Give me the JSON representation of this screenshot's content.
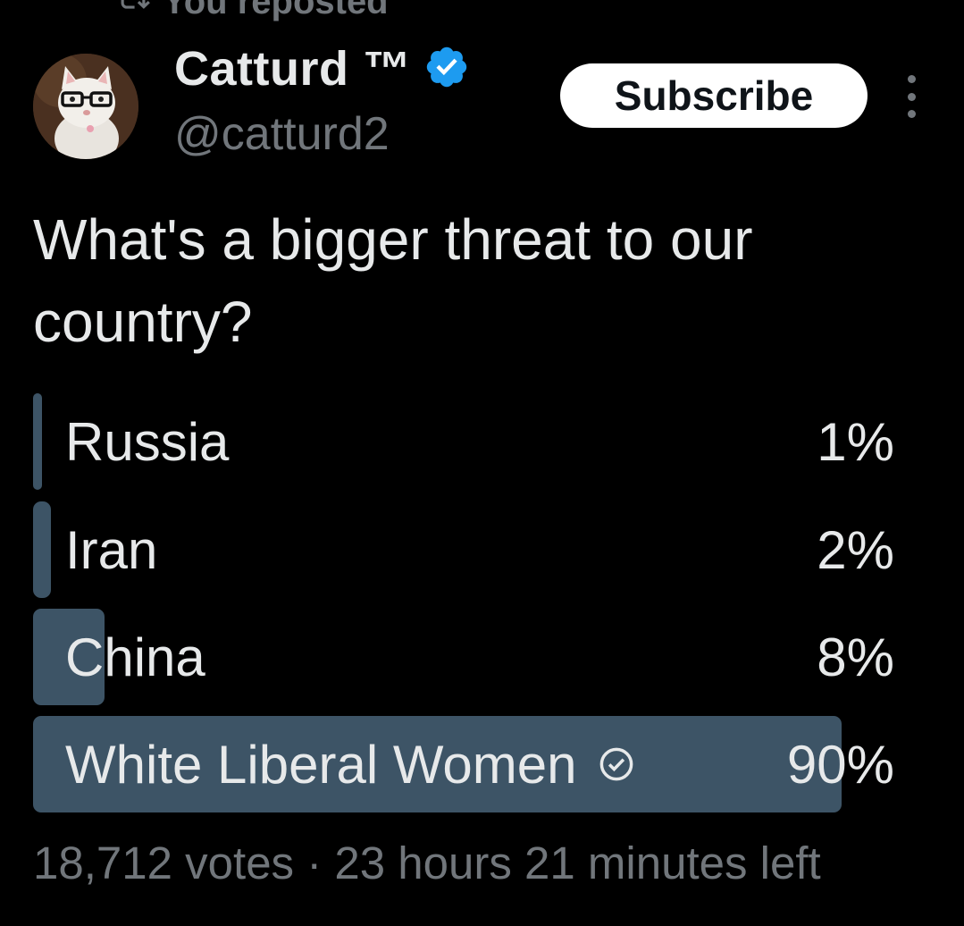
{
  "repost": {
    "label": "You reposted",
    "icon": "repost-icon"
  },
  "author": {
    "display_name": "Catturd ™",
    "handle": "@catturd2",
    "verified_icon": "verified-badge-icon",
    "verified_color": "#1d9bf0"
  },
  "actions": {
    "subscribe_label": "Subscribe",
    "more_icon": "more-options-icon"
  },
  "tweet": {
    "text": "What's a bigger threat to our country?"
  },
  "poll": {
    "fill_color": "#3d5466",
    "options": [
      {
        "label": "Russia",
        "percent": "1%",
        "fraction": 0.01
      },
      {
        "label": "Iran",
        "percent": "2%",
        "fraction": 0.02
      },
      {
        "label": "China",
        "percent": "8%",
        "fraction": 0.08
      },
      {
        "label": "White Liberal Women",
        "percent": "90%",
        "fraction": 0.9,
        "selected": true
      }
    ],
    "votes": "18,712 votes",
    "separator": "·",
    "time_left": "23 hours 21 minutes left"
  }
}
